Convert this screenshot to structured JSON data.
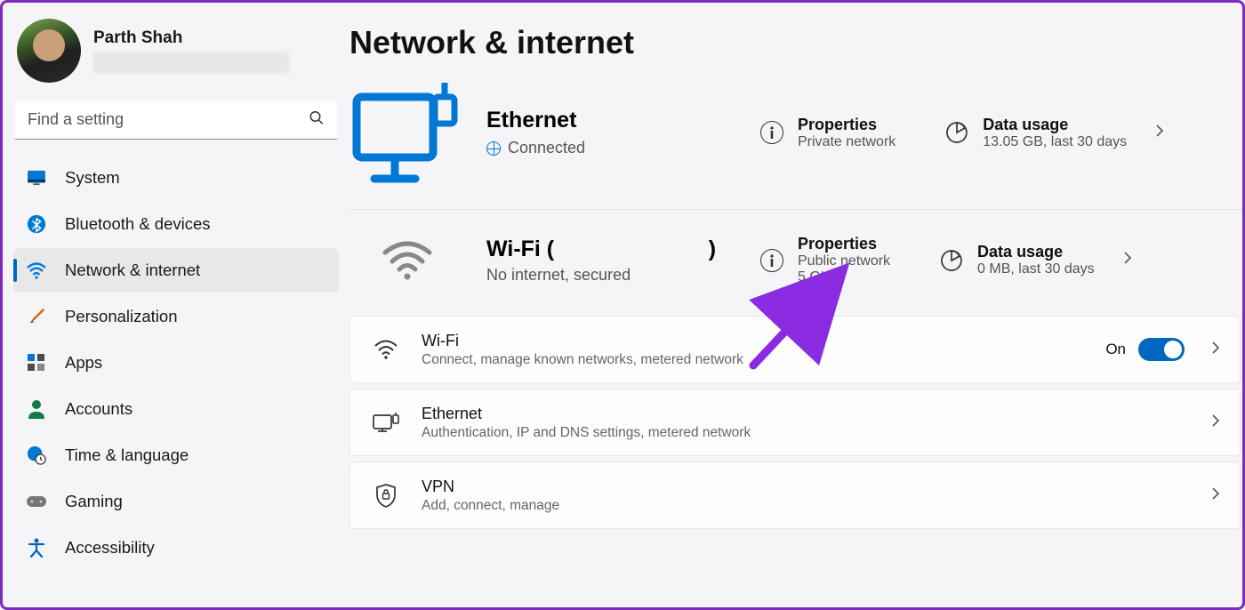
{
  "user": {
    "name": "Parth Shah"
  },
  "search": {
    "placeholder": "Find a setting"
  },
  "nav": [
    {
      "label": "System"
    },
    {
      "label": "Bluetooth & devices"
    },
    {
      "label": "Network & internet"
    },
    {
      "label": "Personalization"
    },
    {
      "label": "Apps"
    },
    {
      "label": "Accounts"
    },
    {
      "label": "Time & language"
    },
    {
      "label": "Gaming"
    },
    {
      "label": "Accessibility"
    }
  ],
  "page": {
    "title": "Network & internet"
  },
  "ethernet": {
    "title": "Ethernet",
    "status": "Connected",
    "properties": {
      "title": "Properties",
      "sub": "Private network"
    },
    "usage": {
      "title": "Data usage",
      "sub": "13.05 GB, last 30 days"
    }
  },
  "wifi_hero": {
    "title_prefix": "Wi-Fi (",
    "title_suffix": ")",
    "status": "No internet, secured",
    "properties": {
      "title": "Properties",
      "sub1": "Public network",
      "sub2": "5 GHz"
    },
    "usage": {
      "title": "Data usage",
      "sub": "0 MB, last 30 days"
    }
  },
  "cards": {
    "wifi": {
      "title": "Wi-Fi",
      "sub": "Connect, manage known networks, metered network",
      "toggle_label": "On"
    },
    "ethernet": {
      "title": "Ethernet",
      "sub": "Authentication, IP and DNS settings, metered network"
    },
    "vpn": {
      "title": "VPN",
      "sub": "Add, connect, manage"
    }
  }
}
